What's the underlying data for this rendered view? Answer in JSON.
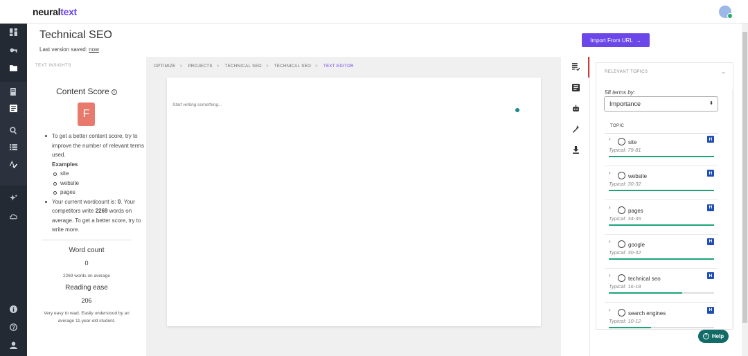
{
  "header": {
    "logo_main": "neural",
    "logo_accent": "text"
  },
  "page": {
    "title": "Technical SEO",
    "saved_prefix": "Last version saved:",
    "saved_link": "now",
    "import_button": "Import From URL",
    "import_arrow": "→"
  },
  "insights": {
    "heading": "TEXT INSIGHTS",
    "content_score_title": "Content Score",
    "info_glyph": "i",
    "grade": "F",
    "tip1": "To get a better content score, try to improve the number of relevant terms used.",
    "examples_label": "Examples",
    "examples": [
      "site",
      "website",
      "pages"
    ],
    "tip2_a": "Your current wordcount is: ",
    "tip2_count": "0",
    "tip2_b": ". Your competitors write ",
    "tip2_avg": "2269",
    "tip2_c": " words on average. To get a better score, try to write more.",
    "word_count_label": "Word count",
    "word_count_value": "0",
    "word_count_note": "2269 words on average",
    "reading_ease_label": "Reading ease",
    "reading_ease_value": "206",
    "reading_ease_note": "Very easy to read. Easily understood by an average 11-year-old student."
  },
  "breadcrumb": {
    "items": [
      "OPTIMIZE",
      "PROJECTS",
      "TECHNICAL SEO",
      "TECHNICAL SEO",
      "TEXT EDITOR"
    ],
    "separator": ">"
  },
  "editor": {
    "placeholder": "Start writing something..."
  },
  "topics": {
    "heading": "RELEVANT TOPICS",
    "caret": "⌄",
    "terms_by": "58 terms by:",
    "sort_value": "Importance",
    "sort_arrows": "⬍",
    "column_header": "TOPIC",
    "badge": "H",
    "chevron": "›",
    "items": [
      {
        "name": "site",
        "typical": "Typical: 79-81",
        "progress": 1.0
      },
      {
        "name": "website",
        "typical": "Typical: 30-32",
        "progress": 1.0
      },
      {
        "name": "pages",
        "typical": "Typical: 34-36",
        "progress": 1.0
      },
      {
        "name": "google",
        "typical": "Typical: 30-32",
        "progress": 1.0
      },
      {
        "name": "technical seo",
        "typical": "Typical: 16-18",
        "progress": 0.7
      },
      {
        "name": "search engines",
        "typical": "Typical: 10-12",
        "progress": 0.4
      }
    ]
  },
  "help": {
    "label": "Help",
    "glyph": "?"
  },
  "colors": {
    "accent": "#6b46e8",
    "grade_bg": "#e8796d",
    "progress": "#1ba37a",
    "help": "#126b66",
    "rail": "#232a34"
  }
}
